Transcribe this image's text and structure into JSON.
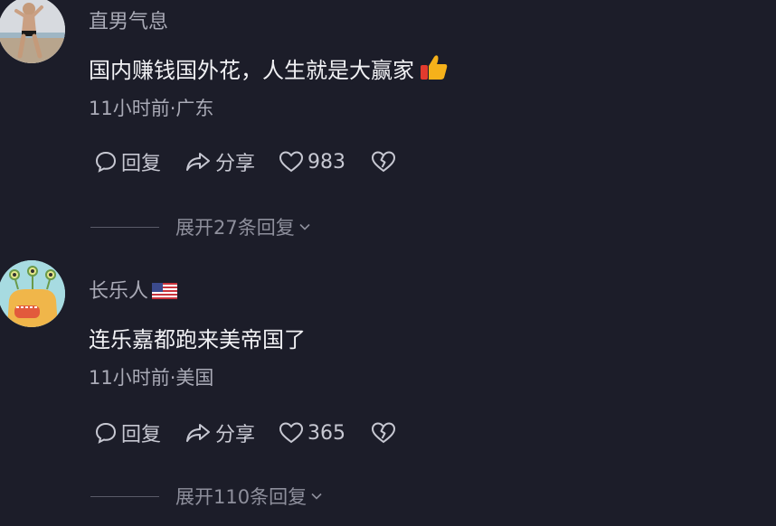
{
  "comments": [
    {
      "username": "直男气息",
      "text": "国内赚钱国外花，人生就是大赢家",
      "meta": "11小时前·广东",
      "reply_label": "回复",
      "share_label": "分享",
      "likes": "983",
      "expand_label": "展开27条回复",
      "emoji": "thumbs-up-icon"
    },
    {
      "username": "长乐人",
      "text": "连乐嘉都跑来美帝国了",
      "meta": "11小时前·美国",
      "reply_label": "回复",
      "share_label": "分享",
      "likes": "365",
      "expand_label": "展开110条回复",
      "flag": "us-flag-icon"
    }
  ],
  "colors": {
    "background": "#1c1d29",
    "username": "#a9aab6",
    "text": "#f1f1f4",
    "action": "#c7c8d2",
    "expand": "#8e8f9c"
  }
}
